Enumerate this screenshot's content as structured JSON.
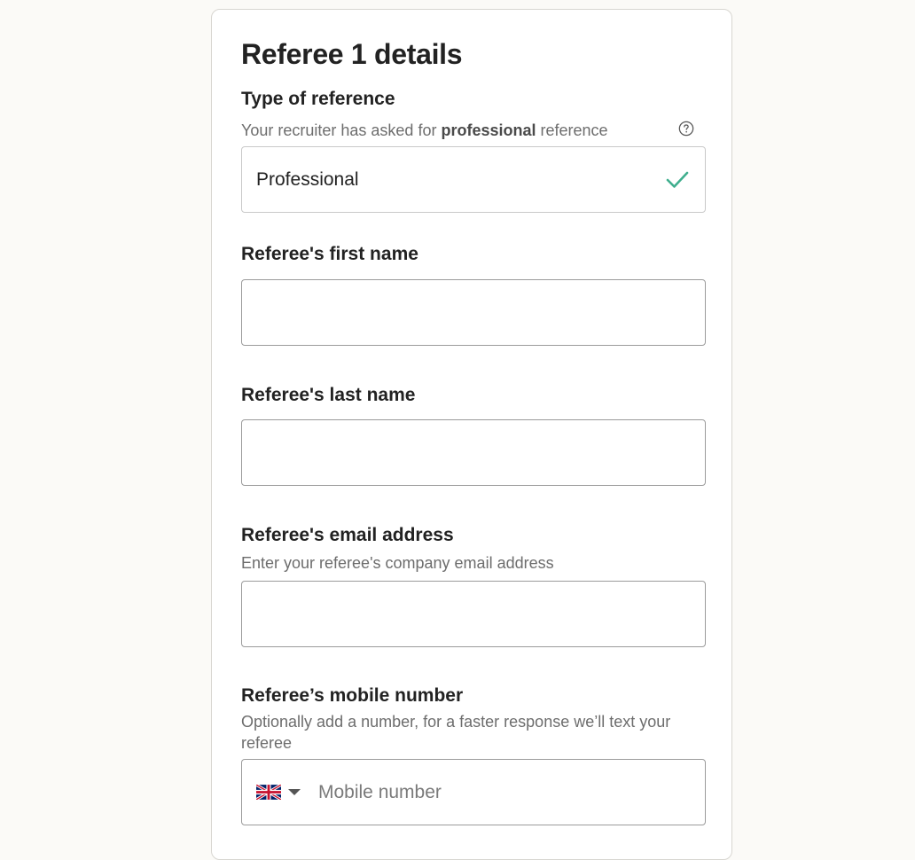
{
  "card": {
    "title": "Referee 1 details"
  },
  "reference_type": {
    "label": "Type of reference",
    "hint_prefix": "Your recruiter has asked for ",
    "hint_bold": "professional",
    "hint_suffix": " reference",
    "selected_value": "Professional",
    "help_icon": "question-circle-icon",
    "check_icon": "check-icon",
    "check_color": "#3fae8e"
  },
  "first_name": {
    "label": "Referee's first name",
    "value": ""
  },
  "last_name": {
    "label": "Referee's last name",
    "value": ""
  },
  "email": {
    "label": "Referee's email address",
    "hint": "Enter your referee's company email address",
    "value": ""
  },
  "mobile": {
    "label": "Referee’s mobile number",
    "hint": "Optionally add a number, for a faster response we’ll text your referee",
    "placeholder": "Mobile number",
    "country_flag": "uk-flag-icon",
    "dropdown_icon": "caret-down-icon",
    "value": ""
  }
}
